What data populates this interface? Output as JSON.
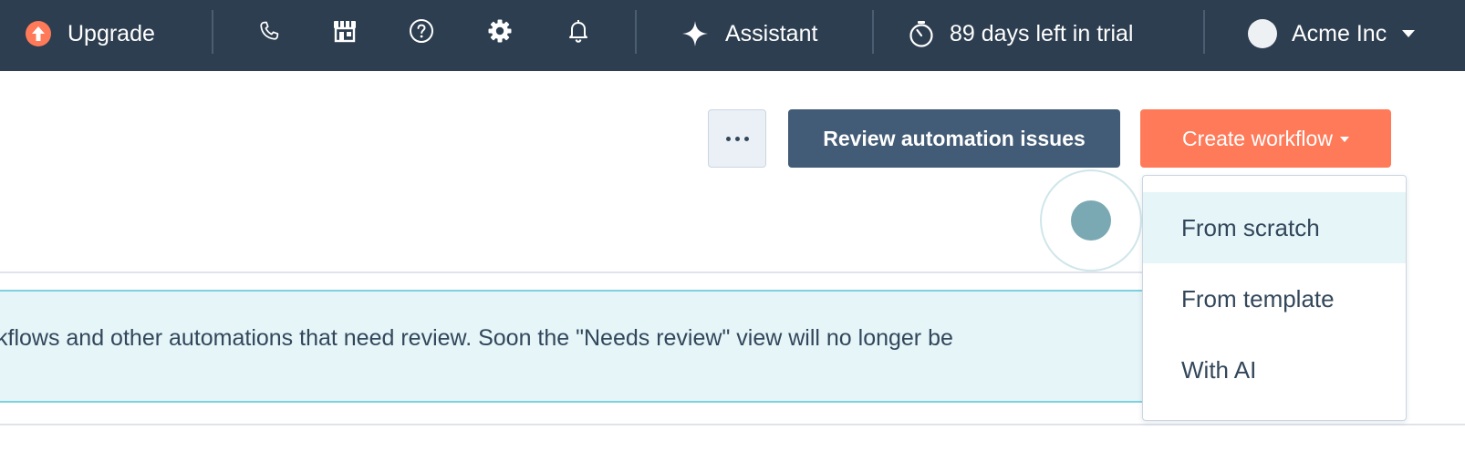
{
  "topbar": {
    "upgrade_label": "Upgrade",
    "assistant_label": "Assistant",
    "trial_text": "89 days left in trial",
    "account_name": "Acme Inc",
    "icons": [
      "phone-icon",
      "marketplace-icon",
      "help-icon",
      "settings-icon",
      "notifications-icon",
      "sparkle-icon",
      "timer-icon",
      "avatar",
      "chevron-down-icon"
    ]
  },
  "toolbar": {
    "more_label": "",
    "review_label": "Review automation issues",
    "create_label": "Create workflow"
  },
  "banner": {
    "text": "kflows and other automations that need review. Soon the \"Needs review\" view will no longer be"
  },
  "dropdown": {
    "items": [
      {
        "label": "From scratch"
      },
      {
        "label": "From template"
      },
      {
        "label": "With AI"
      }
    ]
  },
  "colors": {
    "topbar_bg": "#2d3e50",
    "accent_orange": "#ff7a59",
    "secondary_button": "#425b76",
    "banner_bg": "#e5f5f8",
    "banner_border": "#7fd1de"
  }
}
